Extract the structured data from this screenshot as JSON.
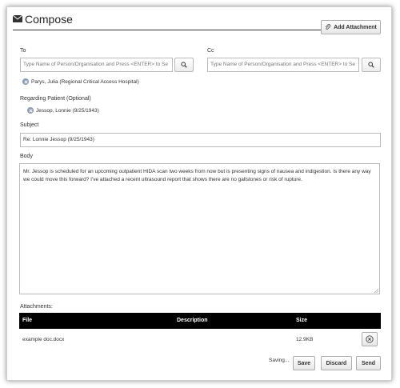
{
  "header": {
    "title": "Compose",
    "add_attachment_label": "Add Attachment"
  },
  "to": {
    "label": "To",
    "placeholder": "Type Name of Person/Organisation and Press <ENTER> to Se",
    "recipients": [
      "Parys, Julia (Regional Critical Access Hospital)"
    ]
  },
  "cc": {
    "label": "Cc",
    "placeholder": "Type Name of Person/Organisation and Press <ENTER> to Se"
  },
  "regarding": {
    "label": "Regarding Patient (Optional)",
    "patient": "Jessop, Lonnie (9/25/1943)"
  },
  "subject": {
    "label": "Subject",
    "value": "Re: Lonnie Jessop (9/25/1943)"
  },
  "body": {
    "label": "Body",
    "value": "Mr. Jessop is scheduled for an upcoming outpatient HIDA scan two weeks from now but is presenting signs of nausea and indigestion. Is there any way we could move this forward? I've attached a recent ultrasound report that shows there are no gallstones or risk of rupture."
  },
  "attachments": {
    "label": "Attachments:",
    "columns": [
      "File",
      "Description",
      "Size"
    ],
    "rows": [
      {
        "file": "example doc.docx",
        "description": "",
        "size": "12.9KB"
      }
    ]
  },
  "footer": {
    "status": "Saving...",
    "save_label": "Save",
    "discard_label": "Discard",
    "send_label": "Send"
  }
}
